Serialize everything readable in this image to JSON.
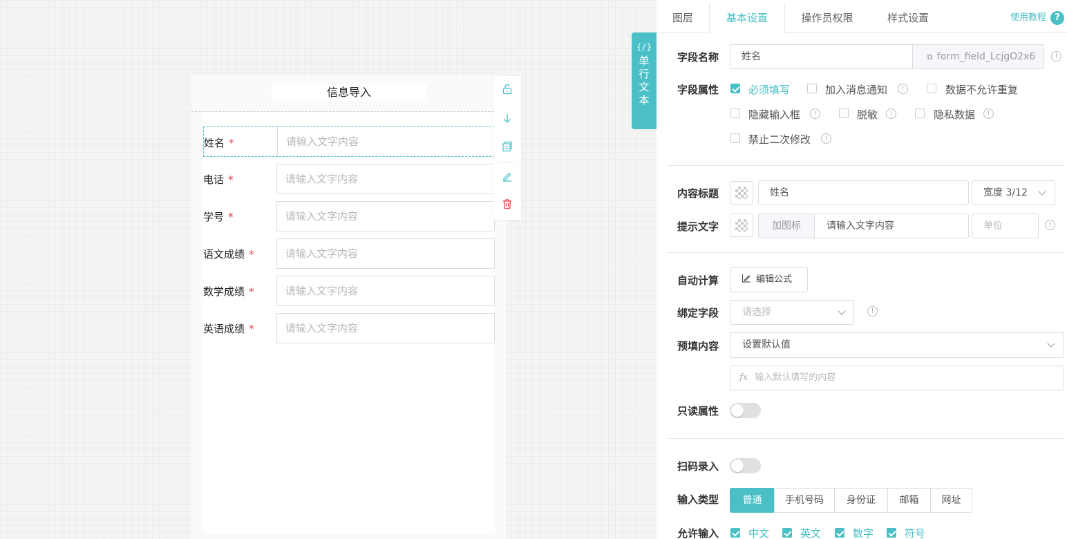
{
  "form": {
    "title": "信息导入",
    "fields": [
      {
        "label": "姓名",
        "placeholder": "请输入文字内容"
      },
      {
        "label": "电话",
        "placeholder": "请输入文字内容"
      },
      {
        "label": "学号",
        "placeholder": "请输入文字内容"
      },
      {
        "label": "语文成绩",
        "placeholder": "请输入文字内容"
      },
      {
        "label": "数学成绩",
        "placeholder": "请输入文字内容"
      },
      {
        "label": "英语成绩",
        "placeholder": "请输入文字内容"
      }
    ],
    "required_mark": "*"
  },
  "toolbar": {
    "icons": [
      "unlock-icon",
      "arrow-down-icon",
      "copy-icon",
      "edit-icon",
      "trash-icon"
    ]
  },
  "component_tag": {
    "code": "{/}",
    "name_chars": [
      "单",
      "行",
      "文",
      "本"
    ]
  },
  "panel": {
    "tabs": [
      "图层",
      "基本设置",
      "操作员权限",
      "样式设置"
    ],
    "active_tab": "基本设置",
    "help": "使用教程",
    "help_icon": "?",
    "field_name": {
      "label": "字段名称",
      "value": "姓名",
      "id": "form_field_LcjgO2x6"
    },
    "field_props": {
      "label": "字段属性",
      "options": [
        {
          "label": "必须填写",
          "checked": true
        },
        {
          "label": "加入消息通知",
          "checked": false
        },
        {
          "label": "数据不允许重复",
          "checked": false
        },
        {
          "label": "隐藏输入框",
          "checked": false
        },
        {
          "label": "脱敏",
          "checked": false
        },
        {
          "label": "隐私数据",
          "checked": false
        },
        {
          "label": "禁止二次修改",
          "checked": false
        }
      ]
    },
    "content_title": {
      "label": "内容标题",
      "value": "姓名",
      "width": "宽度 3/12"
    },
    "hint": {
      "label": "提示文字",
      "add_icon": "加图标",
      "value": "请输入文字内容",
      "unit_placeholder": "单位"
    },
    "auto_calc": {
      "label": "自动计算",
      "button": "编辑公式"
    },
    "bind_field": {
      "label": "绑定字段",
      "placeholder": "请选择"
    },
    "prefill": {
      "label": "预填内容",
      "select": "设置默认值",
      "fx": "fx",
      "input_placeholder": "输入默认填写的内容"
    },
    "readonly": {
      "label": "只读属性",
      "on": false
    },
    "scan": {
      "label": "扫码录入",
      "on": false
    },
    "input_type": {
      "label": "输入类型",
      "options": [
        "普通",
        "手机号码",
        "身份证",
        "邮箱",
        "网址"
      ],
      "selected": "普通"
    },
    "allow_input": {
      "label": "允许输入",
      "options": [
        "中文",
        "英文",
        "数字",
        "符号"
      ]
    }
  },
  "colors": {
    "accent": "#4ac0c6",
    "required": "#e04343"
  }
}
